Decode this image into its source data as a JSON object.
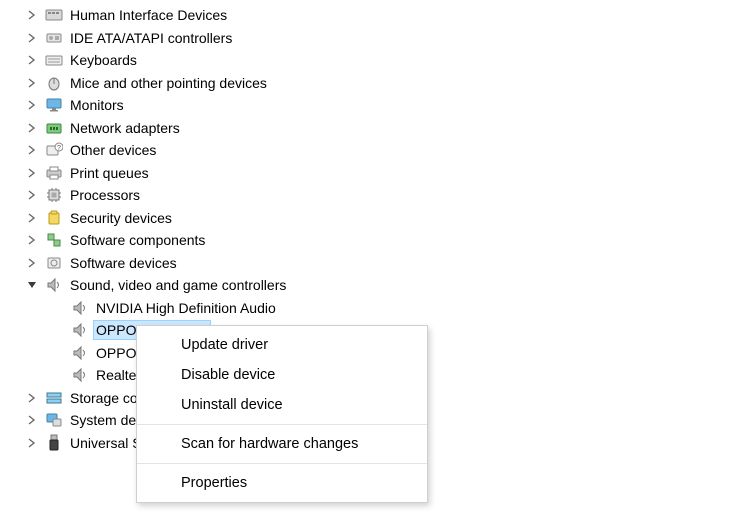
{
  "tree": {
    "categories": [
      {
        "label": "Human Interface Devices",
        "icon": "hid"
      },
      {
        "label": "IDE ATA/ATAPI controllers",
        "icon": "ide"
      },
      {
        "label": "Keyboards",
        "icon": "keyboard"
      },
      {
        "label": "Mice and other pointing devices",
        "icon": "mouse"
      },
      {
        "label": "Monitors",
        "icon": "monitor"
      },
      {
        "label": "Network adapters",
        "icon": "network"
      },
      {
        "label": "Other devices",
        "icon": "other"
      },
      {
        "label": "Print queues",
        "icon": "printer"
      },
      {
        "label": "Processors",
        "icon": "cpu"
      },
      {
        "label": "Security devices",
        "icon": "security"
      },
      {
        "label": "Software components",
        "icon": "swcomp"
      },
      {
        "label": "Software devices",
        "icon": "swdev"
      }
    ],
    "sound_category": {
      "label": "Sound, video and game controllers",
      "children": [
        {
          "label": "NVIDIA High Definition Audio"
        },
        {
          "label": "OPPO Enco Buds",
          "selected": true
        },
        {
          "label": "OPPO Enco Buds"
        },
        {
          "label": "Realtek(R) Audio"
        }
      ]
    },
    "tail_categories": [
      {
        "label": "Storage controllers",
        "icon": "storage"
      },
      {
        "label": "System devices",
        "icon": "system"
      },
      {
        "label": "Universal Serial Bus controllers",
        "icon": "usb"
      }
    ]
  },
  "context_menu": {
    "update": "Update driver",
    "disable": "Disable device",
    "uninstall": "Uninstall device",
    "scan": "Scan for hardware changes",
    "properties": "Properties"
  }
}
